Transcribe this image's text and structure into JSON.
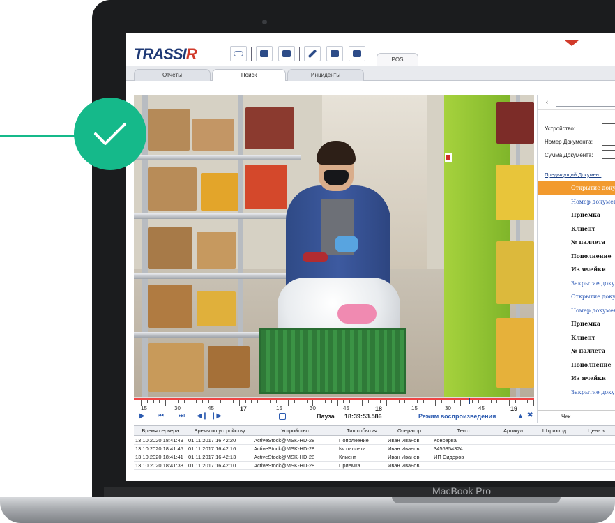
{
  "app": {
    "logo_main": "TRASSI",
    "logo_accent": "R",
    "pos_tab": "POS"
  },
  "tabs": [
    {
      "label": "Отчёты"
    },
    {
      "label": "Поиск"
    },
    {
      "label": "Инциденты"
    }
  ],
  "timeline": {
    "labels": [
      {
        "text": "15"
      },
      {
        "text": "30"
      },
      {
        "text": "45"
      },
      {
        "text": "17",
        "big": true
      },
      {
        "text": "15"
      },
      {
        "text": "30"
      },
      {
        "text": "45"
      },
      {
        "text": "18",
        "big": true
      },
      {
        "text": "15"
      },
      {
        "text": "30"
      },
      {
        "text": "45"
      },
      {
        "text": "19",
        "big": true
      }
    ]
  },
  "transport": {
    "pause_label": "Пауза",
    "time": "18:39:53.586",
    "mode_label": "Режим воспроизведения"
  },
  "pos_panel": {
    "fields": [
      {
        "label": "Устройство:"
      },
      {
        "label": "Номер Документа:"
      },
      {
        "label": "Сумма Документа:"
      }
    ],
    "prev_link": "Предыдущий Документ",
    "rows": [
      {
        "text": "Открытие доку",
        "style": "orange"
      },
      {
        "text": "Номер докумен",
        "style": "blue"
      },
      {
        "text": "Приемка",
        "style": "bold"
      },
      {
        "text": "Клиент",
        "style": "bold"
      },
      {
        "text": "№ паллета",
        "style": "bold"
      },
      {
        "text": "Пополнение",
        "style": "bold"
      },
      {
        "text": "Из ячейки",
        "style": "bold"
      },
      {
        "text": "Закрытие доку",
        "style": "blue"
      },
      {
        "text": "Открытие доку",
        "style": "blue"
      },
      {
        "text": "Номер докумен",
        "style": "blue"
      },
      {
        "text": "Приемка",
        "style": "bold"
      },
      {
        "text": "Клиент",
        "style": "bold"
      },
      {
        "text": "№ паллета",
        "style": "bold"
      },
      {
        "text": "Пополнение",
        "style": "bold"
      },
      {
        "text": "Из ячейки",
        "style": "bold"
      },
      {
        "text": "Закрытие доку",
        "style": "blue"
      }
    ],
    "bottom_label": "Чек"
  },
  "table": {
    "headers": [
      "Время сервера",
      "Время по устройству",
      "Устройство",
      "Тип события",
      "Оператор",
      "Текст",
      "Артикул",
      "Штрихкод",
      "Цена з"
    ],
    "rows": [
      [
        "13.10.2020 18:41:49",
        "01.11.2017 16:42:20",
        "ActiveStock@MSK-HD-28",
        "Пополнение",
        "Иван Иванов",
        "Консерва",
        "",
        "",
        ""
      ],
      [
        "13.10.2020 18:41:45",
        "01.11.2017 16:42:16",
        "ActiveStock@MSK-HD-28",
        "№ паллета",
        "Иван Иванов",
        "3456354324",
        "",
        "",
        ""
      ],
      [
        "13.10.2020 18:41:41",
        "01.11.2017 16:42:13",
        "ActiveStock@MSK-HD-28",
        "Клиент",
        "Иван Иванов",
        "ИП Сидоров",
        "",
        "",
        ""
      ],
      [
        "13.10.2020 18:41:38",
        "01.11.2017 16:42:10",
        "ActiveStock@MSK-HD-28",
        "Приемка",
        "Иван Иванов",
        "",
        "",
        "",
        ""
      ]
    ]
  },
  "laptop": {
    "brand": "MacBook Pro"
  },
  "colors": {
    "check_green": "#15b98a",
    "accent_blue": "#2c5bb0",
    "highlight_orange": "#f29a2e"
  }
}
